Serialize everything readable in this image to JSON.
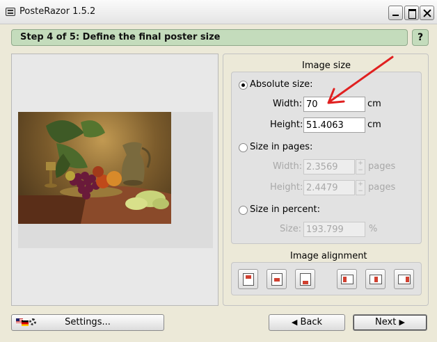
{
  "window": {
    "title": "PosteRazor 1.5.2"
  },
  "step": {
    "title": "Step 4 of 5: Define the final poster size",
    "help_label": "?"
  },
  "image_size": {
    "group_title": "Image size",
    "absolute": {
      "label": "Absolute size:",
      "selected": true,
      "width_label": "Width:",
      "width_value": "70",
      "width_unit": "cm",
      "height_label": "Height:",
      "height_value": "51.4063",
      "height_unit": "cm"
    },
    "pages": {
      "label": "Size in pages:",
      "selected": false,
      "width_label": "Width:",
      "width_value": "2.3569",
      "width_unit": "pages",
      "height_label": "Height:",
      "height_value": "2.4479",
      "height_unit": "pages"
    },
    "percent": {
      "label": "Size in percent:",
      "selected": false,
      "size_label": "Size:",
      "size_value": "193.799",
      "size_unit": "%"
    }
  },
  "alignment": {
    "group_title": "Image alignment"
  },
  "buttons": {
    "settings": "Settings...",
    "back": "Back",
    "next": "Next"
  },
  "colors": {
    "step_bar": "#c4dcbc",
    "annotation_arrow": "#e02020"
  }
}
